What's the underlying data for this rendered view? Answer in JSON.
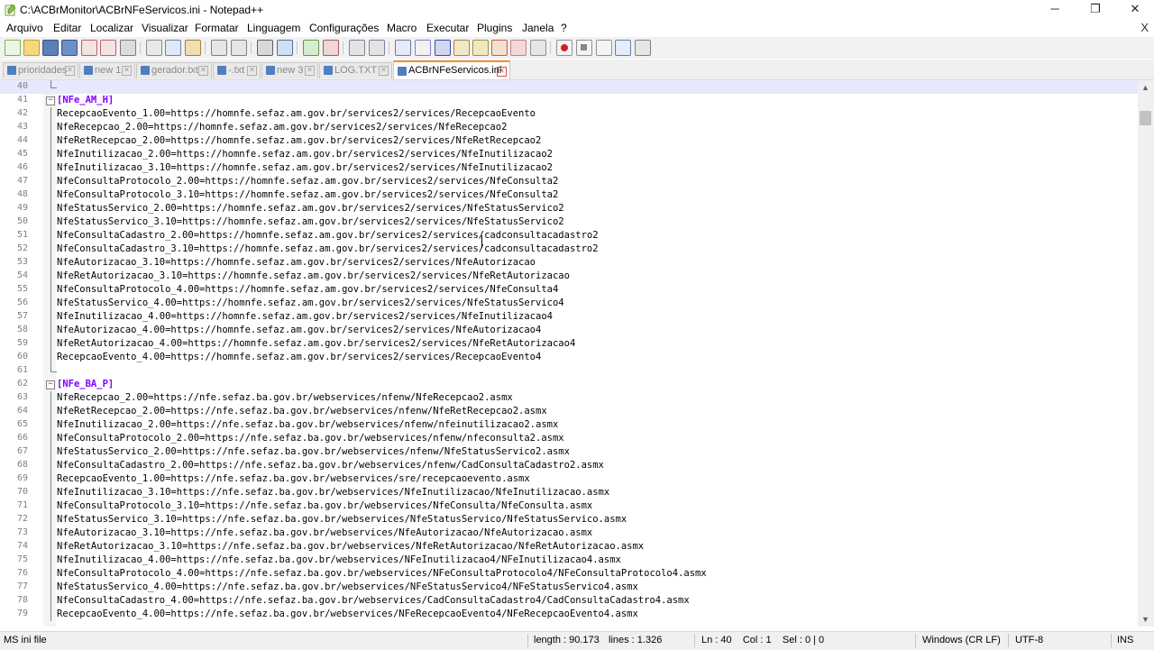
{
  "window": {
    "title": "C:\\ACBrMonitor\\ACBrNFeServicos.ini - Notepad++",
    "minimize_glyph": "─",
    "maximize_glyph": "❐",
    "close_glyph": "✕"
  },
  "menu": {
    "items": [
      "Arquivo",
      "Editar",
      "Localizar",
      "Visualizar",
      "Formatar",
      "Linguagem",
      "Configurações",
      "Macro",
      "Executar",
      "Plugins",
      "Janela",
      "?"
    ],
    "close_glyph": "X"
  },
  "tabs": [
    {
      "label": "prioridades",
      "active": false
    },
    {
      "label": "new 1",
      "active": false
    },
    {
      "label": "gerador.txt",
      "active": false
    },
    {
      "label": "-.txt",
      "active": false
    },
    {
      "label": "new 3",
      "active": false
    },
    {
      "label": "LOG.TXT",
      "active": false
    },
    {
      "label": "ACBrNFeServicos.ini",
      "active": true
    }
  ],
  "editor": {
    "current_line": 40,
    "lines": [
      {
        "n": "40",
        "text": ""
      },
      {
        "n": "41",
        "text": "[NFe_AM_H]",
        "section": true
      },
      {
        "n": "42",
        "text": "RecepcaoEvento_1.00=https://homnfe.sefaz.am.gov.br/services2/services/RecepcaoEvento"
      },
      {
        "n": "43",
        "text": "NfeRecepcao_2.00=https://homnfe.sefaz.am.gov.br/services2/services/NfeRecepcao2"
      },
      {
        "n": "44",
        "text": "NfeRetRecepcao_2.00=https://homnfe.sefaz.am.gov.br/services2/services/NfeRetRecepcao2"
      },
      {
        "n": "45",
        "text": "NfeInutilizacao_2.00=https://homnfe.sefaz.am.gov.br/services2/services/NfeInutilizacao2"
      },
      {
        "n": "46",
        "text": "NfeInutilizacao_3.10=https://homnfe.sefaz.am.gov.br/services2/services/NfeInutilizacao2"
      },
      {
        "n": "47",
        "text": "NfeConsultaProtocolo_2.00=https://homnfe.sefaz.am.gov.br/services2/services/NfeConsulta2"
      },
      {
        "n": "48",
        "text": "NfeConsultaProtocolo_3.10=https://homnfe.sefaz.am.gov.br/services2/services/NfeConsulta2"
      },
      {
        "n": "49",
        "text": "NfeStatusServico_2.00=https://homnfe.sefaz.am.gov.br/services2/services/NfeStatusServico2"
      },
      {
        "n": "50",
        "text": "NfeStatusServico_3.10=https://homnfe.sefaz.am.gov.br/services2/services/NfeStatusServico2"
      },
      {
        "n": "51",
        "text": "NfeConsultaCadastro_2.00=https://homnfe.sefaz.am.gov.br/services2/services/cadconsultacadastro2"
      },
      {
        "n": "52",
        "text": "NfeConsultaCadastro_3.10=https://homnfe.sefaz.am.gov.br/services2/services/cadconsultacadastro2"
      },
      {
        "n": "53",
        "text": "NfeAutorizacao_3.10=https://homnfe.sefaz.am.gov.br/services2/services/NfeAutorizacao"
      },
      {
        "n": "54",
        "text": "NfeRetAutorizacao_3.10=https://homnfe.sefaz.am.gov.br/services2/services/NfeRetAutorizacao"
      },
      {
        "n": "55",
        "text": "NfeConsultaProtocolo_4.00=https://homnfe.sefaz.am.gov.br/services2/services/NfeConsulta4"
      },
      {
        "n": "56",
        "text": "NfeStatusServico_4.00=https://homnfe.sefaz.am.gov.br/services2/services/NfeStatusServico4"
      },
      {
        "n": "57",
        "text": "NfeInutilizacao_4.00=https://homnfe.sefaz.am.gov.br/services2/services/NfeInutilizacao4"
      },
      {
        "n": "58",
        "text": "NfeAutorizacao_4.00=https://homnfe.sefaz.am.gov.br/services2/services/NfeAutorizacao4"
      },
      {
        "n": "59",
        "text": "NfeRetAutorizacao_4.00=https://homnfe.sefaz.am.gov.br/services2/services/NfeRetAutorizacao4"
      },
      {
        "n": "60",
        "text": "RecepcaoEvento_4.00=https://homnfe.sefaz.am.gov.br/services2/services/RecepcaoEvento4"
      },
      {
        "n": "61",
        "text": ""
      },
      {
        "n": "62",
        "text": "[NFe_BA_P]",
        "section": true
      },
      {
        "n": "63",
        "text": "NfeRecepcao_2.00=https://nfe.sefaz.ba.gov.br/webservices/nfenw/NfeRecepcao2.asmx"
      },
      {
        "n": "64",
        "text": "NfeRetRecepcao_2.00=https://nfe.sefaz.ba.gov.br/webservices/nfenw/NfeRetRecepcao2.asmx"
      },
      {
        "n": "65",
        "text": "NfeInutilizacao_2.00=https://nfe.sefaz.ba.gov.br/webservices/nfenw/nfeinutilizacao2.asmx"
      },
      {
        "n": "66",
        "text": "NfeConsultaProtocolo_2.00=https://nfe.sefaz.ba.gov.br/webservices/nfenw/nfeconsulta2.asmx"
      },
      {
        "n": "67",
        "text": "NfeStatusServico_2.00=https://nfe.sefaz.ba.gov.br/webservices/nfenw/NfeStatusServico2.asmx"
      },
      {
        "n": "68",
        "text": "NfeConsultaCadastro_2.00=https://nfe.sefaz.ba.gov.br/webservices/nfenw/CadConsultaCadastro2.asmx"
      },
      {
        "n": "69",
        "text": "RecepcaoEvento_1.00=https://nfe.sefaz.ba.gov.br/webservices/sre/recepcaoevento.asmx"
      },
      {
        "n": "70",
        "text": "NfeInutilizacao_3.10=https://nfe.sefaz.ba.gov.br/webservices/NfeInutilizacao/NfeInutilizacao.asmx"
      },
      {
        "n": "71",
        "text": "NfeConsultaProtocolo_3.10=https://nfe.sefaz.ba.gov.br/webservices/NfeConsulta/NfeConsulta.asmx"
      },
      {
        "n": "72",
        "text": "NfeStatusServico_3.10=https://nfe.sefaz.ba.gov.br/webservices/NfeStatusServico/NfeStatusServico.asmx"
      },
      {
        "n": "73",
        "text": "NfeAutorizacao_3.10=https://nfe.sefaz.ba.gov.br/webservices/NfeAutorizacao/NfeAutorizacao.asmx"
      },
      {
        "n": "74",
        "text": "NfeRetAutorizacao_3.10=https://nfe.sefaz.ba.gov.br/webservices/NfeRetAutorizacao/NfeRetAutorizacao.asmx"
      },
      {
        "n": "75",
        "text": "NfeInutilizacao_4.00=https://nfe.sefaz.ba.gov.br/webservices/NFeInutilizacao4/NFeInutilizacao4.asmx"
      },
      {
        "n": "76",
        "text": "NfeConsultaProtocolo_4.00=https://nfe.sefaz.ba.gov.br/webservices/NFeConsultaProtocolo4/NFeConsultaProtocolo4.asmx"
      },
      {
        "n": "77",
        "text": "NfeStatusServico_4.00=https://nfe.sefaz.ba.gov.br/webservices/NFeStatusServico4/NFeStatusServico4.asmx"
      },
      {
        "n": "78",
        "text": "NfeConsultaCadastro_4.00=https://nfe.sefaz.ba.gov.br/webservices/CadConsultaCadastro4/CadConsultaCadastro4.asmx"
      },
      {
        "n": "79",
        "text": "RecepcaoEvento_4.00=https://nfe.sefaz.ba.gov.br/webservices/NFeRecepcaoEvento4/NFeRecepcaoEvento4.asmx"
      }
    ]
  },
  "status": {
    "file_type": "MS ini file",
    "length": "length : 90.173",
    "lines": "lines : 1.326",
    "position": "Ln : 40    Col : 1    Sel : 0 | 0",
    "eol": "Windows (CR LF)",
    "encoding": "UTF-8",
    "mode": "INS"
  },
  "colors": {
    "section_header": "#8000ff",
    "active_tab_accent": "#fa8e2b",
    "current_line_bg": "#e8e8ff"
  },
  "toolbar_icons": [
    "new-file-icon",
    "open-file-icon",
    "save-icon",
    "save-all-icon",
    "close-icon",
    "close-all-icon",
    "print-icon",
    "cut-icon",
    "copy-icon",
    "paste-icon",
    "undo-icon",
    "redo-icon",
    "find-icon",
    "replace-icon",
    "zoom-in-icon",
    "zoom-out-icon",
    "sync-vertical-icon",
    "sync-horizontal-icon",
    "word-wrap-icon",
    "show-all-chars-icon",
    "indent-guide-icon",
    "doc-map-icon",
    "function-list-icon",
    "folder-workspace-icon",
    "monitoring-icon",
    "record-macro-icon",
    "stop-macro-icon",
    "play-macro-icon",
    "run-macro-multiple-icon",
    "save-macro-icon"
  ]
}
